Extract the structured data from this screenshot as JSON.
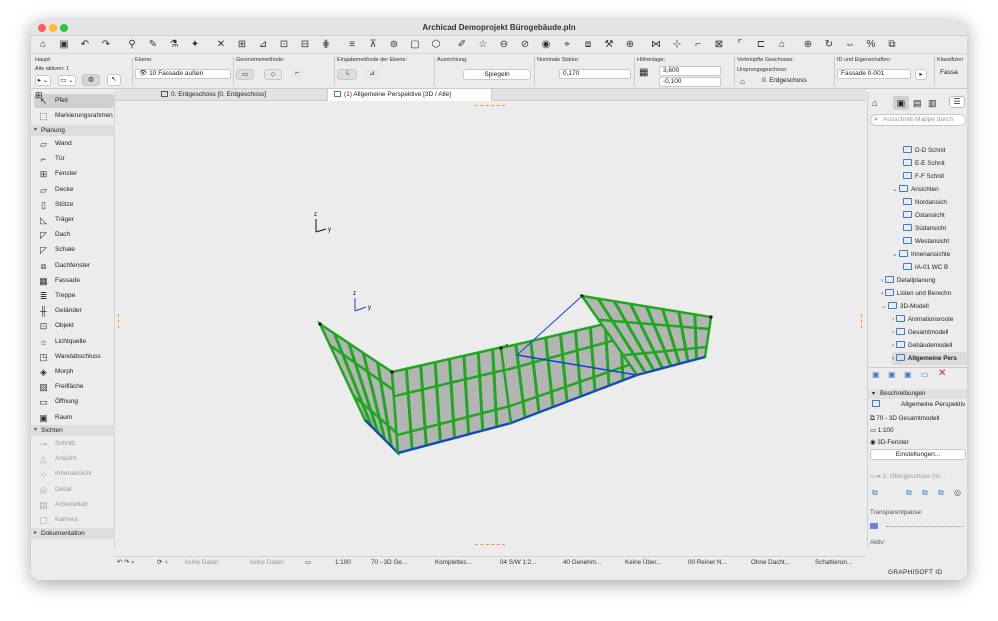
{
  "window": {
    "title": "Archicad Demoprojekt Bürogebäude.pln",
    "traffic_colors": [
      "#ff5f57",
      "#febc2e",
      "#28c840"
    ]
  },
  "toolbar": {
    "icons": [
      "home-icon",
      "save-icon",
      "undo-icon",
      "redo-icon",
      "pick-icon",
      "eyedropper-icon",
      "inject-icon",
      "magic-wand-icon",
      "crosshair-icon",
      "snap-icon",
      "guide-icon",
      "grid-snap-icon",
      "measure-icon",
      "layers-icon",
      "align-icon",
      "elevation-icon",
      "lock-icon",
      "box-icon",
      "3d-view-icon",
      "pen-icon",
      "star-icon",
      "section-icon",
      "elevation-view-icon",
      "camera-icon",
      "tag-icon",
      "paint-icon",
      "tools-icon",
      "globe-icon",
      "split-icon",
      "adjust-icon",
      "trim-icon",
      "intersect-icon",
      "fillet-icon",
      "offset-icon",
      "roof-icon",
      "move-icon",
      "rotate-icon",
      "mirror-icon",
      "percent-icon",
      "copy-icon"
    ]
  },
  "infobox": {
    "haupt_label": "Haupt:",
    "alle_aktiven": "Alle aktiven: 1",
    "ebene_label": "Ebene:",
    "ebene_value": "10 Fassade außen",
    "geometrie_label": "Geometriemethode:",
    "eingabe_label": "Eingabemethode der Ebene:",
    "ausrichtung_label": "Ausrichtung:",
    "ausrichtung_btn": "Spiegeln",
    "staerke_label": "Nominale Stärke:",
    "staerke_value": "0,170",
    "hoehen_label": "Höhenlage:",
    "hoehen_top": "3,600",
    "hoehen_bottom": "-0,100",
    "verknuepfte_label": "Verknüpfte Geschosse:",
    "ursprung_label": "Ursprungsgeschoss:",
    "ursprung_value": "0. Erdgeschoss",
    "id_label": "ID und Eigenschaften:",
    "id_value": "Fassade 0-001",
    "klass_label": "Klassifizier",
    "klass_value": "Fassa"
  },
  "tabs": [
    {
      "label": "0. Erdgeschoss [0. Erdgeschoss]"
    },
    {
      "label": "(1) Allgemeine Perspektive [3D / Alle]"
    }
  ],
  "toolbox": {
    "arrow": "Pfeil",
    "marquee": "Markierungsrahmen",
    "sections": [
      "Planung",
      "Sichten",
      "Dokumentation"
    ],
    "planung": [
      "Wand",
      "Tür",
      "Fenster",
      "Decke",
      "Stütze",
      "Träger",
      "Dach",
      "Schale",
      "Dachfenster",
      "Fassade",
      "Treppe",
      "Geländer",
      "Objekt",
      "Lichtquelle",
      "Wandabschluss",
      "Morph",
      "Freifläche",
      "Öffnung",
      "Raum"
    ],
    "sichten": [
      "Schnitt",
      "Ansicht",
      "Innenansicht",
      "Detail",
      "Arbeitsblatt",
      "Kamera"
    ]
  },
  "viewport": {
    "axis_z": "z",
    "axis_y": "y",
    "facade_green": "#1fa81f",
    "panel_gray": "#b4b4b4",
    "edge_blue": "#1a3fd6"
  },
  "navigator": {
    "search_placeholder": "Ausschnitt-Mappe durch",
    "items": [
      {
        "label": "D-D Schnit",
        "indent": 3
      },
      {
        "label": "E-E Schnit",
        "indent": 3
      },
      {
        "label": "F-F Schnit",
        "indent": 3
      },
      {
        "label": "Ansichten",
        "indent": 2
      },
      {
        "label": "Nordansich",
        "indent": 3
      },
      {
        "label": "Ostansicht",
        "indent": 3
      },
      {
        "label": "Südansicht",
        "indent": 3
      },
      {
        "label": "Westansicht",
        "indent": 3
      },
      {
        "label": "Innenansichte",
        "indent": 2
      },
      {
        "label": "IA-01 WC B",
        "indent": 3
      },
      {
        "label": "Detailplanung",
        "indent": 1
      },
      {
        "label": "Listen und Berechn",
        "indent": 1
      },
      {
        "label": "3D-Modell",
        "indent": 1
      },
      {
        "label": "Animationsroute",
        "indent": 2
      },
      {
        "label": "Gesamtmodell",
        "indent": 2
      },
      {
        "label": "Gebäudemodell",
        "indent": 2
      },
      {
        "label": "Allgemeine Pers",
        "indent": 2
      }
    ],
    "beschreibungen_label": "Beschreibungen",
    "beschreibung_value": "Allgemeine Perspektiv",
    "model_value": "70 - 3D Gesamtmodell",
    "scale_value": "1:100",
    "fenster_value": "3D-Fenster",
    "einstellungen_btn": "Einstellungen...",
    "geschoss_value": "2. Obergeschoss (IA...",
    "transparent_label": "Transparentpause:",
    "aktiv_label": "Aktiv:",
    "brand": "GRAPHISOFT ID"
  },
  "statusbar": {
    "keine_daten_1": "keine Daten",
    "keine_daten_2": "keine Daten",
    "scale": "1:100",
    "model": "70 - 3D Ge...",
    "komplett": "Komplettes...",
    "sw": "04 S/W 1:2...",
    "genehm": "40 Genehm...",
    "ueber": "Keine Über...",
    "reiner": "00 Reiner N...",
    "dacht": "Ohne Dacht...",
    "schatt": "Schattierun..."
  }
}
